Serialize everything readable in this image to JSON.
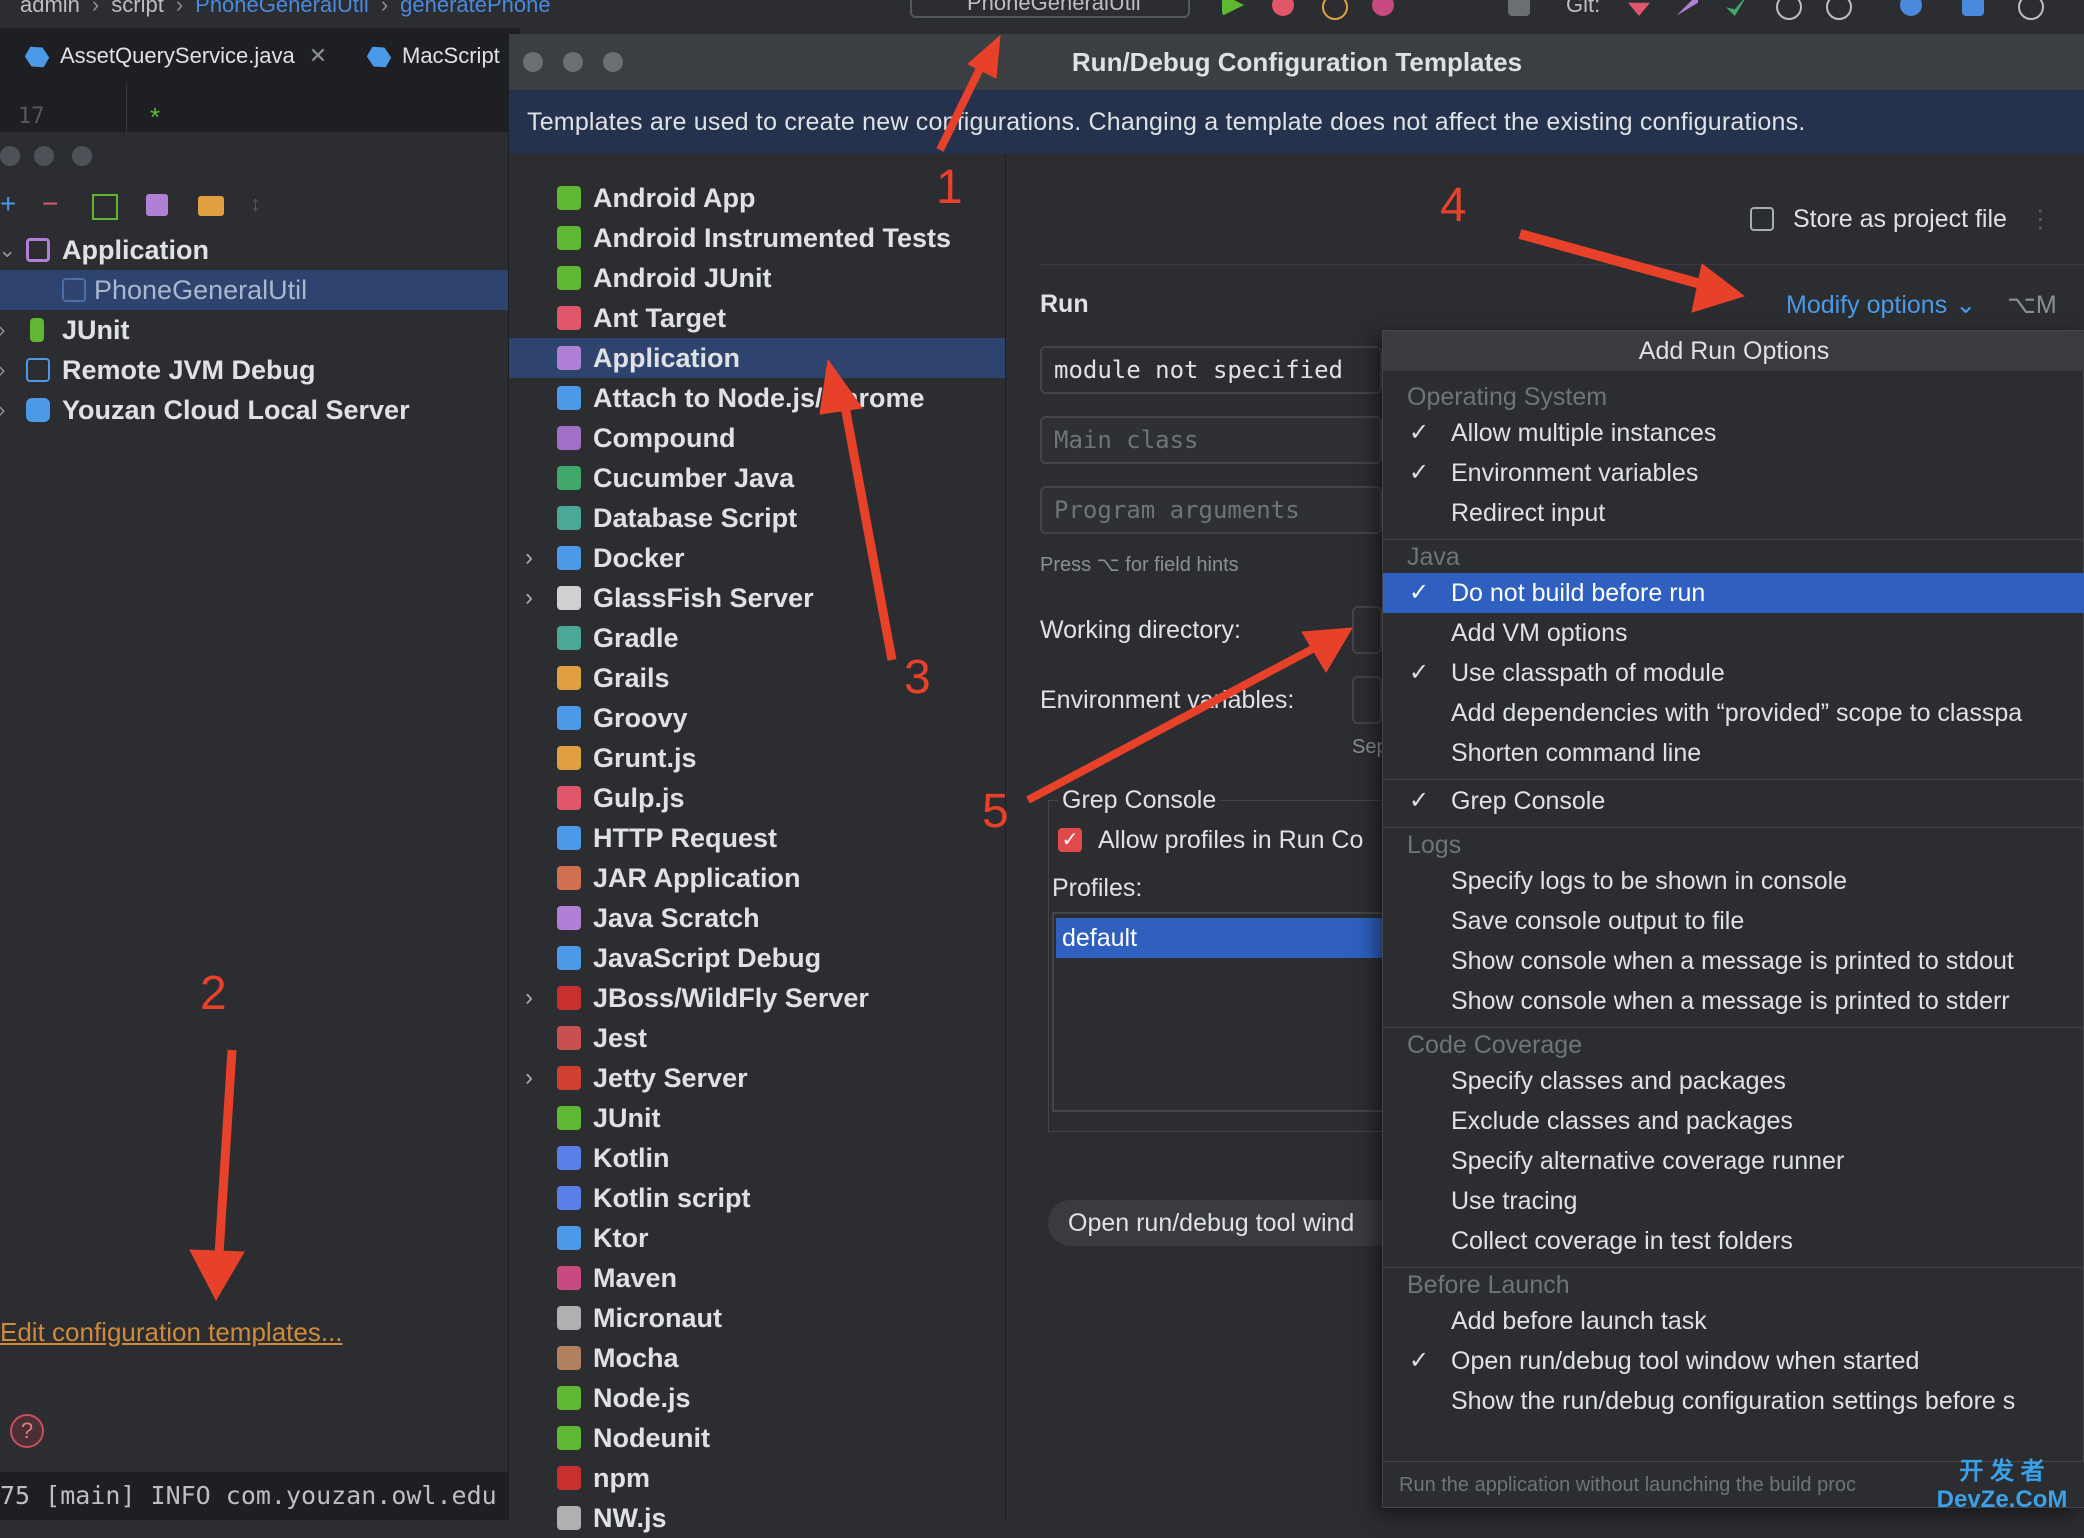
{
  "topbar": {
    "crumbs": [
      "admin",
      "script",
      "PhoneGeneralUtil",
      "generatePhone"
    ],
    "run_config": "PhoneGeneralUtil",
    "git_label": "Git:"
  },
  "editor": {
    "tabs": [
      {
        "label": "AssetQueryService.java"
      },
      {
        "label": "MacScript"
      }
    ],
    "line_number": "17"
  },
  "left_panel": {
    "tree": [
      {
        "label": "Application",
        "expanded": true,
        "icon": "application-icon"
      },
      {
        "label": "PhoneGeneralUtil",
        "child": true,
        "selected": true,
        "icon": "application-icon"
      },
      {
        "label": "JUnit",
        "icon": "junit-icon"
      },
      {
        "label": "Remote JVM Debug",
        "icon": "remote-debug-icon"
      },
      {
        "label": "Youzan Cloud Local Server",
        "icon": "youzan-icon"
      }
    ],
    "edit_templates_link": "Edit configuration templates...",
    "console_text": "75 [main] INFO com.youzan.owl.edu"
  },
  "dialog": {
    "title": "Run/Debug Configuration Templates",
    "banner": "Templates are used to create new configurations. Changing a template does not affect the existing configurations.",
    "templates": [
      {
        "label": "Android App",
        "color": "#5fb832"
      },
      {
        "label": "Android Instrumented Tests",
        "color": "#5fb832"
      },
      {
        "label": "Android JUnit",
        "color": "#5fb832"
      },
      {
        "label": "Ant Target",
        "color": "#e0566b"
      },
      {
        "label": "Application",
        "color": "#b07fd6",
        "selected": true
      },
      {
        "label": "Attach to Node.js/Chrome",
        "color": "#4a9ae8"
      },
      {
        "label": "Compound",
        "color": "#a06fc6"
      },
      {
        "label": "Cucumber Java",
        "color": "#3fa86b"
      },
      {
        "label": "Database Script",
        "color": "#4aa896"
      },
      {
        "label": "Docker",
        "color": "#4a9ae8",
        "expandable": true
      },
      {
        "label": "GlassFish Server",
        "color": "#d0d0d0",
        "expandable": true
      },
      {
        "label": "Gradle",
        "color": "#4aa896"
      },
      {
        "label": "Grails",
        "color": "#e0a040"
      },
      {
        "label": "Groovy",
        "color": "#4a9ae8"
      },
      {
        "label": "Grunt.js",
        "color": "#e0a040"
      },
      {
        "label": "Gulp.js",
        "color": "#e0566b"
      },
      {
        "label": "HTTP Request",
        "color": "#4a9ae8"
      },
      {
        "label": "JAR Application",
        "color": "#d07050"
      },
      {
        "label": "Java Scratch",
        "color": "#b07fd6"
      },
      {
        "label": "JavaScript Debug",
        "color": "#4a9ae8"
      },
      {
        "label": "JBoss/WildFly Server",
        "color": "#c83030",
        "expandable": true
      },
      {
        "label": "Jest",
        "color": "#c85050"
      },
      {
        "label": "Jetty Server",
        "color": "#d04030",
        "expandable": true
      },
      {
        "label": "JUnit",
        "color": "#5fb832"
      },
      {
        "label": "Kotlin",
        "color": "#5a7fe8"
      },
      {
        "label": "Kotlin script",
        "color": "#5a7fe8"
      },
      {
        "label": "Ktor",
        "color": "#4a9ae8"
      },
      {
        "label": "Maven",
        "color": "#c84a80"
      },
      {
        "label": "Micronaut",
        "color": "#b0b0b0"
      },
      {
        "label": "Mocha",
        "color": "#b08060"
      },
      {
        "label": "Node.js",
        "color": "#5fb832"
      },
      {
        "label": "Nodeunit",
        "color": "#5fb832"
      },
      {
        "label": "npm",
        "color": "#c83030"
      },
      {
        "label": "NW.js",
        "color": "#b0b0b0"
      }
    ],
    "config": {
      "store_as_project_file": "Store as project file",
      "run_heading": "Run",
      "modify_options": "Modify options",
      "modify_shortcut": "⌥M",
      "module_value": "module not specified",
      "main_class_placeholder": "Main class",
      "program_args_placeholder": "Program arguments",
      "hint": "Press ⌥ for field hints",
      "working_dir_label": "Working directory:",
      "env_vars_label": "Environment variables:",
      "sep_fragment": "Sep",
      "grep_console_title": "Grep Console",
      "allow_profiles": "Allow profiles in Run Co",
      "profiles_label": "Profiles:",
      "profile_default": "default",
      "open_tool_window_chip": "Open run/debug tool wind"
    }
  },
  "popup": {
    "title": "Add Run Options",
    "groups": [
      {
        "name": "Operating System",
        "options": [
          {
            "label": "Allow multiple instances",
            "checked": true
          },
          {
            "label": "Environment variables",
            "checked": true
          },
          {
            "label": "Redirect input",
            "checked": false
          }
        ]
      },
      {
        "name": "Java",
        "options": [
          {
            "label": "Do not build before run",
            "checked": true,
            "selected": true
          },
          {
            "label": "Add VM options",
            "checked": false
          },
          {
            "label": "Use classpath of module",
            "checked": true
          },
          {
            "label": "Add dependencies with “provided” scope to classpa",
            "checked": false
          },
          {
            "label": "Shorten command line",
            "checked": false
          }
        ]
      },
      {
        "name": "",
        "options": [
          {
            "label": "Grep Console",
            "checked": true
          }
        ]
      },
      {
        "name": "Logs",
        "options": [
          {
            "label": "Specify logs to be shown in console",
            "checked": false
          },
          {
            "label": "Save console output to file",
            "checked": false
          },
          {
            "label": "Show console when a message is printed to stdout",
            "checked": false
          },
          {
            "label": "Show console when a message is printed to stderr",
            "checked": false
          }
        ]
      },
      {
        "name": "Code Coverage",
        "options": [
          {
            "label": "Specify classes and packages",
            "checked": false
          },
          {
            "label": "Exclude classes and packages",
            "checked": false
          },
          {
            "label": "Specify alternative coverage runner",
            "checked": false
          },
          {
            "label": "Use tracing",
            "checked": false
          },
          {
            "label": "Collect coverage in test folders",
            "checked": false
          }
        ]
      },
      {
        "name": "Before Launch",
        "options": [
          {
            "label": "Add before launch task",
            "checked": false
          },
          {
            "label": "Open run/debug tool window when started",
            "checked": true
          },
          {
            "label": "Show the run/debug configuration settings before s",
            "checked": false
          }
        ]
      }
    ],
    "footer": "Run the application without launching the build proc"
  },
  "annotations": {
    "n1": "1",
    "n2": "2",
    "n3": "3",
    "n4": "4",
    "n5": "5",
    "color": "#e8412a"
  },
  "watermark": {
    "line1": "开 发 者",
    "line2": "DevZe.CoM"
  }
}
